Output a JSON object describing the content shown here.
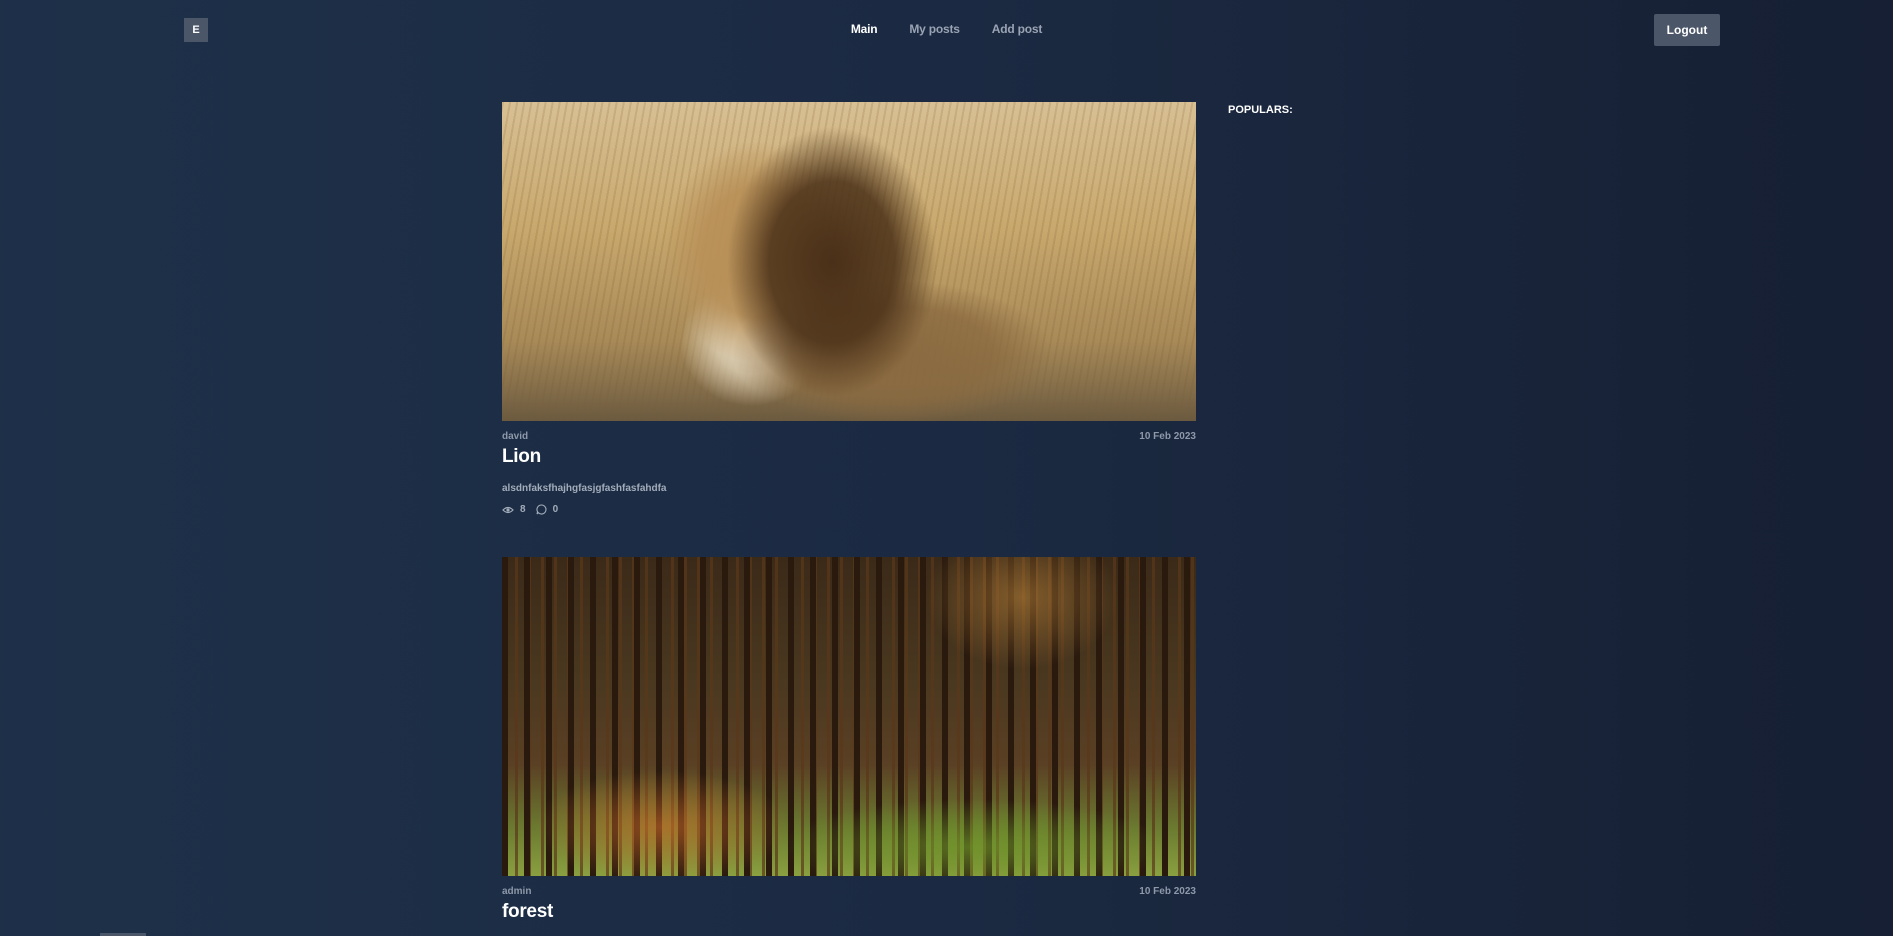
{
  "header": {
    "logo_label": "E",
    "nav": [
      {
        "label": "Main",
        "active": true
      },
      {
        "label": "My posts",
        "active": false
      },
      {
        "label": "Add post",
        "active": false
      }
    ],
    "logout_label": "Logout"
  },
  "posts": [
    {
      "author": "david",
      "date": "10 Feb 2023",
      "title": "Lion",
      "text": "alsdnfaksfhajhgfasjgfashfasfahdfa",
      "views": "8",
      "comments": "0",
      "image_icon": "lion-photo"
    },
    {
      "author": "admin",
      "date": "10 Feb 2023",
      "title": "forest",
      "image_icon": "forest-photo"
    }
  ],
  "sidebar": {
    "populars_label": "POPULARS:"
  },
  "colors": {
    "background": "#1b2a42",
    "button": "#4b5668",
    "muted_text": "#8e98a9"
  }
}
